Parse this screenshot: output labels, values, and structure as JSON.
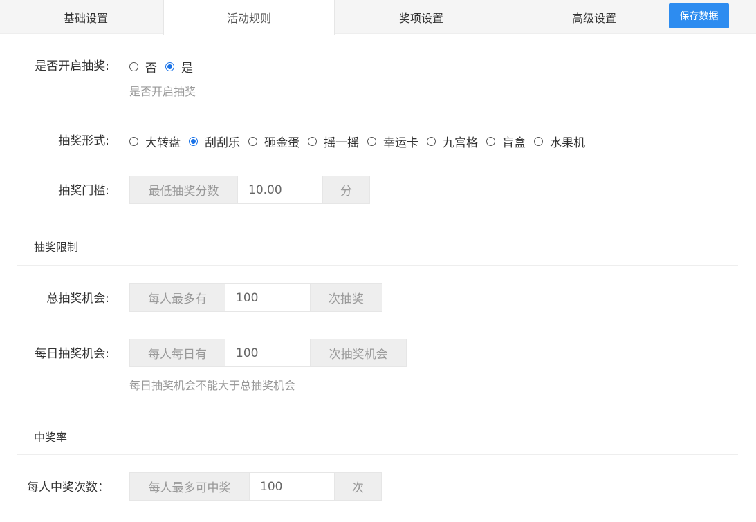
{
  "tabs": [
    {
      "label": "基础设置"
    },
    {
      "label": "活动规则"
    },
    {
      "label": "奖项设置"
    },
    {
      "label": "高级设置"
    }
  ],
  "save_button": "保存数据",
  "enable_lottery": {
    "label": "是否开启抽奖:",
    "options": [
      {
        "label": "否",
        "checked": false
      },
      {
        "label": "是",
        "checked": true
      }
    ],
    "help": "是否开启抽奖"
  },
  "lottery_form": {
    "label": "抽奖形式:",
    "options": [
      {
        "label": "大转盘",
        "checked": false
      },
      {
        "label": "刮刮乐",
        "checked": true
      },
      {
        "label": "砸金蛋",
        "checked": false
      },
      {
        "label": "摇一摇",
        "checked": false
      },
      {
        "label": "幸运卡",
        "checked": false
      },
      {
        "label": "九宫格",
        "checked": false
      },
      {
        "label": "盲盒",
        "checked": false
      },
      {
        "label": "水果机",
        "checked": false
      }
    ]
  },
  "threshold": {
    "label": "抽奖门槛:",
    "prefix": "最低抽奖分数",
    "value": "10.00",
    "suffix": "分"
  },
  "limits_section": {
    "title": "抽奖限制"
  },
  "total_chances": {
    "label": "总抽奖机会:",
    "prefix": "每人最多有",
    "value": "100",
    "suffix": "次抽奖"
  },
  "daily_chances": {
    "label": "每日抽奖机会:",
    "prefix": "每人每日有",
    "value": "100",
    "suffix": "次抽奖机会",
    "help": "每日抽奖机会不能大于总抽奖机会"
  },
  "win_rate_section": {
    "title": "中奖率"
  },
  "win_times": {
    "label": "每人中奖次数：",
    "prefix": "每人最多可中奖",
    "value": "100",
    "suffix": "次"
  },
  "colors": {
    "accent": "#2d8cf0",
    "radio_checked": "#1a73e8",
    "muted": "#999999"
  }
}
